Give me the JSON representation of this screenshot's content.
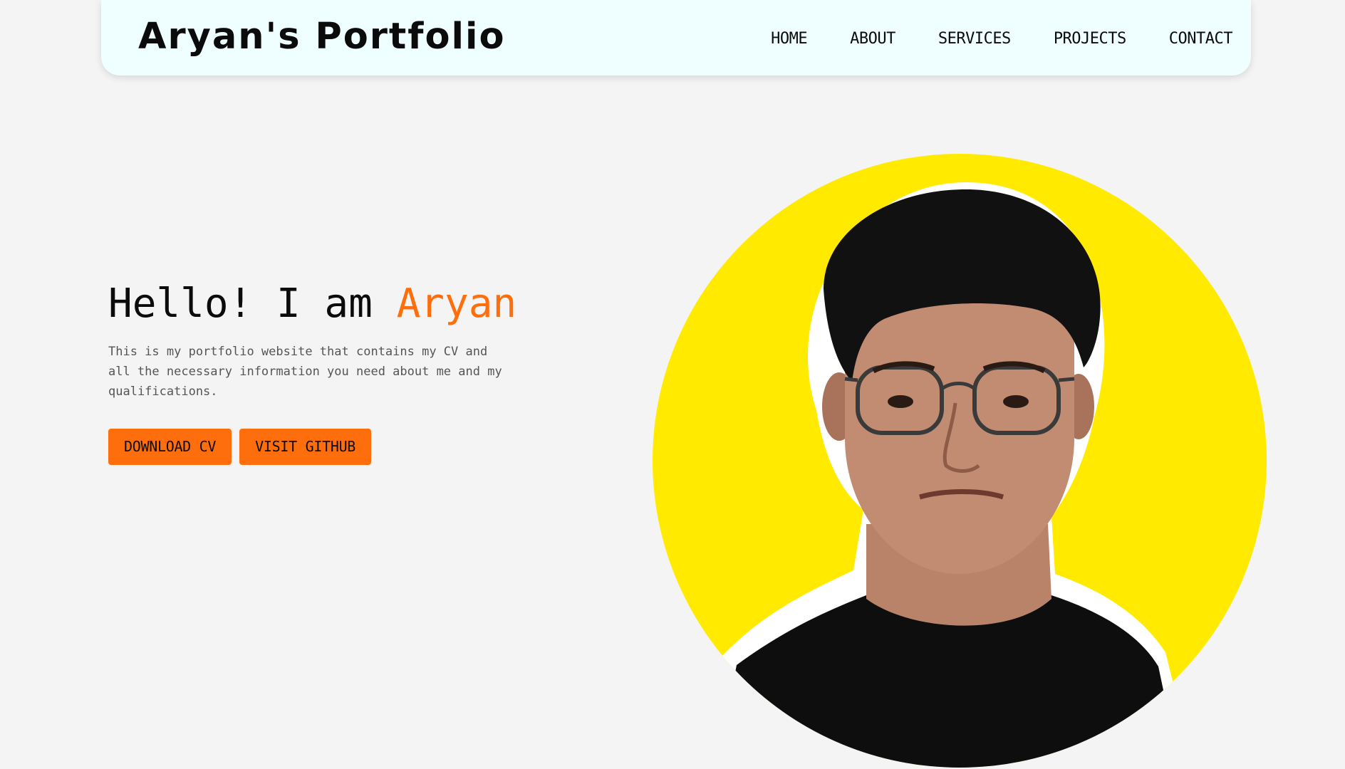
{
  "header": {
    "brand": "Aryan's Portfolio",
    "nav": [
      "HOME",
      "ABOUT",
      "SERVICES",
      "PROJECTS",
      "CONTACT"
    ]
  },
  "hero": {
    "greeting": "Hello! I am ",
    "name": "Aryan",
    "description": "This is my portfolio website that contains my CV and all the necessary information you need about me and my qualifications.",
    "buttons": {
      "download_cv": "DOWNLOAD CV",
      "visit_github": "VISIT GITHUB"
    }
  },
  "colors": {
    "accent": "#ff6e0c",
    "portrait_circle": "#ffea00",
    "navbar_bg": "#effefe",
    "page_bg": "#f4f4f4"
  }
}
